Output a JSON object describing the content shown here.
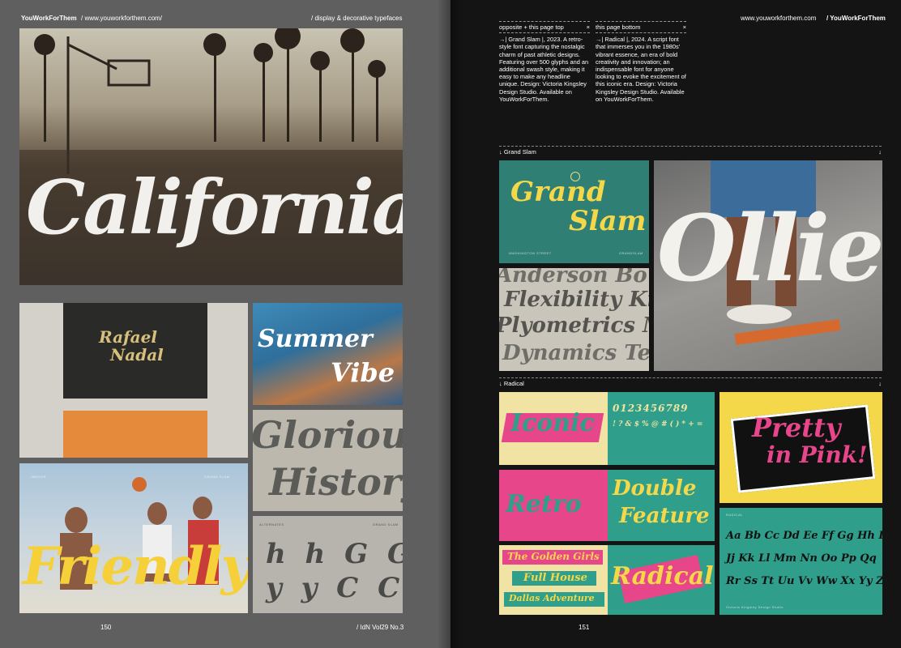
{
  "left_page": {
    "brand": "YouWorkForThem",
    "url": "/ www.youworkforthem.com/",
    "section": "/ display & decorative typefaces",
    "page_number": "150",
    "images": {
      "california": "California",
      "rafael_top": "Rafael",
      "rafael_bottom": "Nadal",
      "summer": "Summer",
      "vibe": "Vibe",
      "glorious": "Glorious",
      "history": "History",
      "friendly": "Friendly",
      "friendly_caption_left": "INDOOR",
      "friendly_caption_right": "GRAND SLAM",
      "alternates_caption_left": "ALTERNATES",
      "alternates_caption_right": "GRAND SLAM",
      "alternates_row1": "h h G G",
      "alternates_row2": "y y C C"
    }
  },
  "right_page": {
    "url": "www.youworkforthem.com",
    "brand": "/ YouWorkForThem",
    "page_number": "151",
    "issue": "/ IdN Vol29 No.3",
    "column1": {
      "tab_label": "opposite + this page top",
      "tab_close": "×",
      "text": "→| Grand Slam |, 2023. A retro-style font capturing the nostalgic charm of past athletic designs. Featuring over 500 glyphs and an additional swash style, making it easy to make any headline unique. Design: Victoria Kingsley Design Studio. Available on YouWorkForThem."
    },
    "column2": {
      "tab_label": "this page bottom",
      "tab_close": "×",
      "text": "→| Radical |, 2024. A script font that immerses you in the 1980s' vibrant essence, an era of bold creativity and innovation; an indispensable font for anyone looking to evoke the excitement of this iconic era. Design: Victoria Kingsley Design Studio. Available on YouWorkForThem."
    },
    "sections": [
      {
        "label": "↓ Grand Slam",
        "arrow": "↓"
      },
      {
        "label": "↓ Radical",
        "arrow": "↓"
      }
    ],
    "images": {
      "grand": "Grand",
      "slam": "Slam",
      "grand_caption": "WASHINGTON STREET",
      "grand_caption_right": "GRANDSLAM",
      "flex_line1": "Anderson Bo",
      "flex_line2": "Flexibility Kine",
      "flex_line3": "Plyometrics Mo",
      "flex_line4": "Dynamics Tends",
      "ollie": "Ollie",
      "iconic": "Iconic",
      "digits": "0123456789",
      "punct": "! ? & $ % @ # ( ) * + =",
      "pretty1": "Pretty",
      "pretty2": "in Pink!",
      "retro": "Retro",
      "double1": "Double",
      "double2": "Feature",
      "golden": "The Golden Girls",
      "fullhouse": "Full House",
      "desktop": "Dallas Adventure",
      "radical": "Radical",
      "alpha1": "Aa Bb Cc Dd Ee Ff Gg Hh Ii",
      "alpha2": "Jj Kk Ll Mm Nn Oo Pp Qq",
      "alpha3": "Rr Ss Tt Uu Vv Ww Xx Yy Zz",
      "radical_caption": "RADICAL",
      "radical_caption_right": "Victoria Kingsley Design Studio"
    }
  },
  "colors": {
    "left_bg": "#5f5f5f",
    "right_bg": "#141414",
    "teal": "#2f9e8a",
    "yellow": "#f4d84a",
    "pink": "#e8468a"
  }
}
